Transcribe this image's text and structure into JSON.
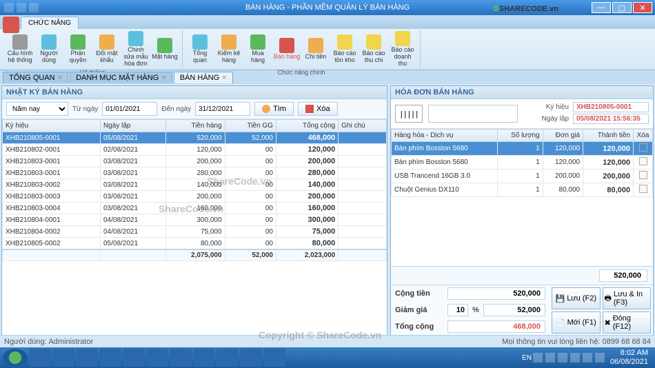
{
  "title_bar": {
    "title": "BÁN HÀNG - PHẦN MỀM QUẢN LÝ BÁN HÀNG",
    "logo_text": "SHARECODE.vn"
  },
  "ribbon": {
    "tab": "CHỨC NĂNG",
    "group1_title": "Hệ thống",
    "group2_title": "Chức năng chính",
    "btns": {
      "cauhinh": "Cấu hình\nhệ thống",
      "nguoidung": "Người\ndùng",
      "phanquyen": "Phân quyền",
      "doimk": "Đổi mật\nkhẩu",
      "chinhsua": "Chinh sửa\nmẫu hóa đơn",
      "mathang": "Mặt hàng",
      "tongquan": "Tổng quan",
      "kiemke": "Kiểm kê\nhàng",
      "muahang": "Mua hàng",
      "banhang": "Bán hàng",
      "chitien": "Chi tiền",
      "tonkho": "Báo cáo\ntồn kho",
      "thuchi": "Báo cáo\nthu chi",
      "doanhthu": "Báo cáo\ndoanh thu"
    }
  },
  "doc_tabs": [
    {
      "label": "TỔNG QUAN"
    },
    {
      "label": "DANH MỤC MẶT HÀNG"
    },
    {
      "label": "BÁN HÀNG"
    }
  ],
  "left": {
    "header": "NHẬT KÝ BÁN HÀNG",
    "filter": {
      "period": "Năm nay",
      "from_lbl": "Từ ngày",
      "from": "01/01/2021",
      "to_lbl": "Đến ngày",
      "to": "31/12/2021",
      "tim": "Tìm",
      "xoa": "Xóa"
    },
    "cols": {
      "kyhieu": "Ký hiệu",
      "ngaylap": "Ngày lập",
      "tienhang": "Tiền hàng",
      "tiengg": "Tiền GG",
      "tongcong": "Tổng cộng",
      "ghichu": "Ghi chú"
    },
    "rows": [
      {
        "kh": "XHB210805-0001",
        "nl": "05/08/2021",
        "th": "520,000",
        "gg": "52,000",
        "tc": "468,000",
        "gc": ""
      },
      {
        "kh": "XHB210802-0001",
        "nl": "02/08/2021",
        "th": "120,000",
        "gg": "00",
        "tc": "120,000",
        "gc": ""
      },
      {
        "kh": "XHB210803-0001",
        "nl": "03/08/2021",
        "th": "200,000",
        "gg": "00",
        "tc": "200,000",
        "gc": ""
      },
      {
        "kh": "XHB210803-0001",
        "nl": "03/08/2021",
        "th": "280,000",
        "gg": "00",
        "tc": "280,000",
        "gc": ""
      },
      {
        "kh": "XHB210803-0002",
        "nl": "03/08/2021",
        "th": "140,000",
        "gg": "00",
        "tc": "140,000",
        "gc": ""
      },
      {
        "kh": "XHB210803-0003",
        "nl": "03/08/2021",
        "th": "200,000",
        "gg": "00",
        "tc": "200,000",
        "gc": ""
      },
      {
        "kh": "XHB210803-0004",
        "nl": "03/08/2021",
        "th": "160,000",
        "gg": "00",
        "tc": "160,000",
        "gc": ""
      },
      {
        "kh": "XHB210804-0001",
        "nl": "04/08/2021",
        "th": "300,000",
        "gg": "00",
        "tc": "300,000",
        "gc": ""
      },
      {
        "kh": "XHB210804-0002",
        "nl": "04/08/2021",
        "th": "75,000",
        "gg": "00",
        "tc": "75,000",
        "gc": ""
      },
      {
        "kh": "XHB210805-0002",
        "nl": "05/08/2021",
        "th": "80,000",
        "gg": "00",
        "tc": "80,000",
        "gc": ""
      }
    ],
    "footer": {
      "th": "2,075,000",
      "gg": "52,000",
      "tc": "2,023,000"
    }
  },
  "right": {
    "header": "HÓA ĐƠN BÁN HÀNG",
    "meta": {
      "kyhieu_lbl": "Ký hiệu",
      "kyhieu": "XHB210805-0001",
      "ngaylap_lbl": "Ngày lập",
      "ngaylap": "05/08/2021 15:56:35"
    },
    "cols": {
      "hh": "Hàng hóa - Dịch vụ",
      "sl": "Số lượng",
      "dg": "Đơn giá",
      "tt": "Thành tiền",
      "xoa": "Xóa"
    },
    "lines": [
      {
        "hh": "Bàn phím Bosston 5680",
        "sl": "1",
        "dg": "120,000",
        "tt": "120,000"
      },
      {
        "hh": "Bàn phím Bosston 5680",
        "sl": "1",
        "dg": "120,000",
        "tt": "120,000"
      },
      {
        "hh": "USB Trancend 16GB 3.0",
        "sl": "1",
        "dg": "200,000",
        "tt": "200,000"
      },
      {
        "hh": "Chuột Genius DX110",
        "sl": "1",
        "dg": "80,000",
        "tt": "80,000"
      }
    ],
    "line_total": "520,000",
    "sum": {
      "congtien_lbl": "Cộng tiền",
      "congtien": "520,000",
      "giamgia_lbl": "Giảm giá",
      "giamgia_pct": "10",
      "pct_sym": "%",
      "giamgia": "52,000",
      "tongcong_lbl": "Tổng cộng",
      "tongcong": "468,000",
      "luu": "Lưu (F2)",
      "luuin": "Lưu & In (F3)",
      "moi": "Mới (F1)",
      "dong": "Đóng (F12)"
    }
  },
  "status": {
    "user_lbl": "Người dùng:",
    "user": "Administrator",
    "contact": "Mọi thông tin vui lòng liên hệ: 0899 68 68 84"
  },
  "taskbar": {
    "lang": "EN",
    "time": "8:02 AM",
    "date": "06/08/2021"
  },
  "watermark": "ShareCode.vn",
  "copyright": "Copyright © ShareCode.vn"
}
